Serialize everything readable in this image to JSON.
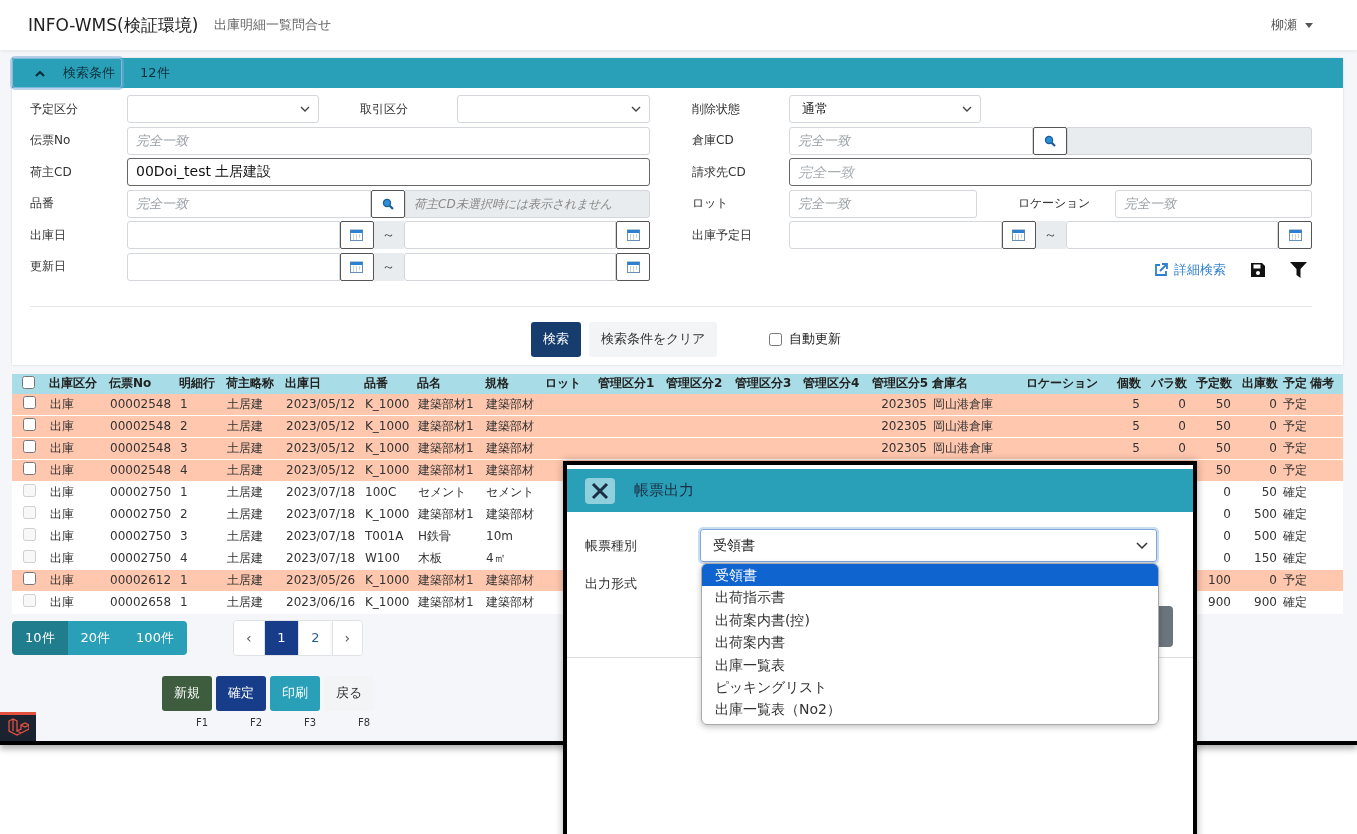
{
  "app": {
    "title": "INFO-WMS(検証環境)",
    "page": "出庫明細一覧問合せ",
    "user": "柳瀬"
  },
  "search_panel": {
    "toggle_label": "検索条件",
    "expanded": true,
    "count": "12件",
    "left": [
      {
        "items": [
          {
            "kind": "select",
            "label": "予定区分"
          },
          {
            "kind": "select",
            "label": "取引区分"
          }
        ]
      },
      {
        "items": [
          {
            "kind": "text",
            "label": "伝票No",
            "placeholder": "完全一致",
            "emphasized": false
          }
        ]
      },
      {
        "items": [
          {
            "kind": "text",
            "label": "荷主CD",
            "value": "00Doi_test 土居建設",
            "emphasized": true
          }
        ]
      },
      {
        "items": [
          {
            "kind": "lookup",
            "label": "品番",
            "placeholder": "完全一致",
            "note_placeholder": "荷主CD未選択時には表示されません"
          }
        ]
      },
      {
        "items": [
          {
            "kind": "date_range",
            "label": "出庫日",
            "separator": "～"
          }
        ]
      },
      {
        "items": [
          {
            "kind": "date_range",
            "label": "更新日",
            "separator": "～"
          }
        ]
      }
    ],
    "right": [
      {
        "items": [
          {
            "kind": "select",
            "label": "削除状態",
            "value": "通常"
          }
        ]
      },
      {
        "items": [
          {
            "kind": "lookup",
            "label": "倉庫CD",
            "placeholder": "完全一致"
          }
        ]
      },
      {
        "items": [
          {
            "kind": "text",
            "label": "請求先CD",
            "placeholder": "完全一致",
            "emphasized": true
          }
        ]
      },
      {
        "items": [
          {
            "kind": "text",
            "label": "ロット",
            "placeholder": "完全一致",
            "emphasized": false
          },
          {
            "kind": "text",
            "label": "ロケーション",
            "placeholder": "完全一致",
            "emphasized": false
          }
        ]
      },
      {
        "items": [
          {
            "kind": "date_range",
            "label": "出庫予定日",
            "separator": "～"
          }
        ]
      }
    ],
    "detail_link": "詳細検索",
    "search_button": "検索",
    "clear_button": "検索条件をクリア",
    "auto_refresh": {
      "label": "自動更新",
      "checked": false
    }
  },
  "table": {
    "select_all": {
      "checked": false
    },
    "columns": [
      {
        "label": "出庫区分",
        "kind": "text"
      },
      {
        "label": "伝票No",
        "kind": "text"
      },
      {
        "label": "明細行",
        "kind": "text"
      },
      {
        "label": "荷主略称",
        "kind": "text"
      },
      {
        "label": "出庫日",
        "kind": "text"
      },
      {
        "label": "品番",
        "kind": "text"
      },
      {
        "label": "品名",
        "kind": "text"
      },
      {
        "label": "規格",
        "kind": "text"
      },
      {
        "label": "ロット",
        "kind": "text"
      },
      {
        "label": "管理区分1",
        "kind": "text"
      },
      {
        "label": "管理区分2",
        "kind": "text"
      },
      {
        "label": "管理区分3",
        "kind": "text"
      },
      {
        "label": "管理区分4",
        "kind": "text"
      },
      {
        "label": "管理区分5",
        "kind": "number"
      },
      {
        "label": "倉庫名",
        "kind": "text"
      },
      {
        "label": "ロケーション",
        "kind": "text"
      },
      {
        "label": "個数",
        "kind": "number"
      },
      {
        "label": "バラ数",
        "kind": "number"
      },
      {
        "label": "予定数",
        "kind": "number"
      },
      {
        "label": "出庫数",
        "kind": "number"
      },
      {
        "label": "予定",
        "kind": "status"
      },
      {
        "label": "備考",
        "kind": "text"
      }
    ],
    "rows": [
      {
        "highlighted": true,
        "checkbox_enabled": true,
        "checked": false,
        "cells": [
          "出庫",
          "00002548",
          "1",
          "土居建",
          "2023/05/12",
          "K_1000",
          "建築部材1",
          "建築部材",
          null,
          null,
          null,
          null,
          null,
          "202305",
          "岡山港倉庫",
          null,
          "5",
          "0",
          "50",
          "0",
          "予定"
        ]
      },
      {
        "highlighted": true,
        "checkbox_enabled": true,
        "checked": false,
        "cells": [
          "出庫",
          "00002548",
          "2",
          "土居建",
          "2023/05/12",
          "K_1000",
          "建築部材1",
          "建築部材",
          null,
          null,
          null,
          null,
          null,
          "202305",
          "岡山港倉庫",
          null,
          "5",
          "0",
          "50",
          "0",
          "予定"
        ]
      },
      {
        "highlighted": true,
        "checkbox_enabled": true,
        "checked": false,
        "cells": [
          "出庫",
          "00002548",
          "3",
          "土居建",
          "2023/05/12",
          "K_1000",
          "建築部材1",
          "建築部材",
          null,
          null,
          null,
          null,
          null,
          "202305",
          "岡山港倉庫",
          null,
          "5",
          "0",
          "50",
          "0",
          "予定"
        ]
      },
      {
        "highlighted": true,
        "checkbox_enabled": true,
        "checked": false,
        "cells": [
          "出庫",
          "00002548",
          "4",
          "土居建",
          "2023/05/12",
          "K_1000",
          "建築部材1",
          "建築部材",
          null,
          null,
          null,
          null,
          null,
          null,
          null,
          null,
          null,
          null,
          "50",
          "0",
          "予定"
        ]
      },
      {
        "highlighted": false,
        "checkbox_enabled": false,
        "checked": false,
        "cells": [
          "出庫",
          "00002750",
          "1",
          "土居建",
          "2023/07/18",
          "100C",
          "セメント",
          "セメント",
          null,
          null,
          null,
          null,
          null,
          null,
          null,
          null,
          null,
          null,
          "0",
          "50",
          "確定"
        ]
      },
      {
        "highlighted": false,
        "checkbox_enabled": false,
        "checked": false,
        "cells": [
          "出庫",
          "00002750",
          "2",
          "土居建",
          "2023/07/18",
          "K_1000",
          "建築部材1",
          "建築部材",
          null,
          null,
          null,
          null,
          null,
          null,
          null,
          null,
          null,
          null,
          "0",
          "500",
          "確定"
        ]
      },
      {
        "highlighted": false,
        "checkbox_enabled": false,
        "checked": false,
        "cells": [
          "出庫",
          "00002750",
          "3",
          "土居建",
          "2023/07/18",
          "T001A",
          "H鉄骨",
          "10m",
          null,
          null,
          null,
          null,
          null,
          null,
          null,
          null,
          null,
          null,
          "0",
          "500",
          "確定"
        ]
      },
      {
        "highlighted": false,
        "checkbox_enabled": false,
        "checked": false,
        "cells": [
          "出庫",
          "00002750",
          "4",
          "土居建",
          "2023/07/18",
          "W100",
          "木板",
          "4㎡",
          null,
          null,
          null,
          null,
          null,
          null,
          null,
          null,
          null,
          null,
          "0",
          "150",
          "確定"
        ]
      },
      {
        "highlighted": true,
        "checkbox_enabled": true,
        "checked": false,
        "cells": [
          "出庫",
          "00002612",
          "1",
          "土居建",
          "2023/05/26",
          "K_1000",
          "建築部材1",
          "建築部材",
          null,
          null,
          null,
          null,
          null,
          null,
          null,
          null,
          null,
          null,
          "100",
          "0",
          "予定"
        ]
      },
      {
        "highlighted": false,
        "checkbox_enabled": false,
        "checked": false,
        "cells": [
          "出庫",
          "00002658",
          "1",
          "土居建",
          "2023/06/16",
          "K_1000",
          "建築部材1",
          "建築部材",
          null,
          null,
          null,
          null,
          null,
          null,
          null,
          null,
          null,
          null,
          "900",
          "900",
          "確定"
        ]
      }
    ]
  },
  "page_sizes": [
    {
      "label": "10件",
      "selected": true
    },
    {
      "label": "20件",
      "selected": false
    },
    {
      "label": "100件",
      "selected": false
    }
  ],
  "pagination": [
    {
      "label": "‹",
      "kind": "nav",
      "selected": false
    },
    {
      "label": "1",
      "kind": "page",
      "selected": true
    },
    {
      "label": "2",
      "kind": "page",
      "selected": false
    },
    {
      "label": "›",
      "kind": "nav",
      "selected": false
    }
  ],
  "footer_buttons": [
    {
      "label": "新規",
      "key": "F1",
      "kind": "new"
    },
    {
      "label": "確定",
      "key": "F2",
      "kind": "confirm"
    },
    {
      "label": "印刷",
      "key": "F3",
      "kind": "print"
    },
    {
      "label": "戻る",
      "key": "F8",
      "kind": "back"
    }
  ],
  "dialog": {
    "title": "帳票出力",
    "fields": [
      {
        "label": "帳票種別",
        "value": "受領書"
      },
      {
        "label": "出力形式"
      }
    ],
    "options": [
      {
        "label": "受領書",
        "selected": true
      },
      {
        "label": "出荷指示書",
        "selected": false
      },
      {
        "label": "出荷案内書(控)",
        "selected": false
      },
      {
        "label": "出荷案内書",
        "selected": false
      },
      {
        "label": "出庫一覧表",
        "selected": false
      },
      {
        "label": "ピッキングリスト",
        "selected": false
      },
      {
        "label": "出庫一覧表（No2）",
        "selected": false
      }
    ]
  }
}
